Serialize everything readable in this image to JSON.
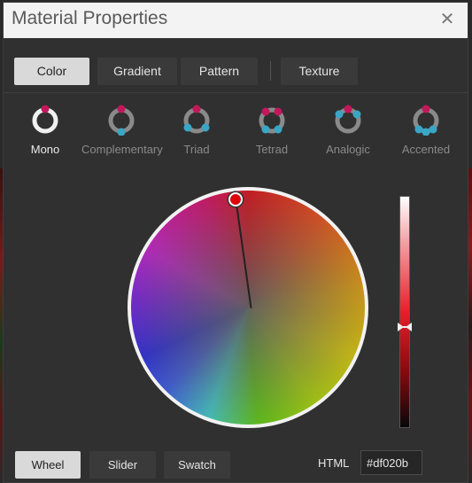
{
  "window": {
    "title": "Material Properties",
    "close_symbol": "✕"
  },
  "tabs": [
    {
      "label": "Color",
      "active": true
    },
    {
      "label": "Gradient",
      "active": false
    },
    {
      "label": "Pattern",
      "active": false
    },
    {
      "label": "Texture",
      "active": false
    }
  ],
  "harmonies": [
    {
      "label": "Mono",
      "active": true,
      "icon": "mono-icon"
    },
    {
      "label": "Complementary",
      "active": false,
      "icon": "complementary-icon"
    },
    {
      "label": "Triad",
      "active": false,
      "icon": "triad-icon"
    },
    {
      "label": "Tetrad",
      "active": false,
      "icon": "tetrad-icon"
    },
    {
      "label": "Analogic",
      "active": false,
      "icon": "analogic-icon"
    },
    {
      "label": "Accented",
      "active": false,
      "icon": "accented-icon"
    }
  ],
  "colors": {
    "selected": "#df020b",
    "accent_pink": "#c2185b",
    "accent_teal": "#3aa6c6"
  },
  "modes": [
    {
      "label": "Wheel",
      "active": true
    },
    {
      "label": "Slider",
      "active": false
    },
    {
      "label": "Swatch",
      "active": false
    }
  ],
  "html_field": {
    "label": "HTML",
    "value": "#df020b"
  }
}
